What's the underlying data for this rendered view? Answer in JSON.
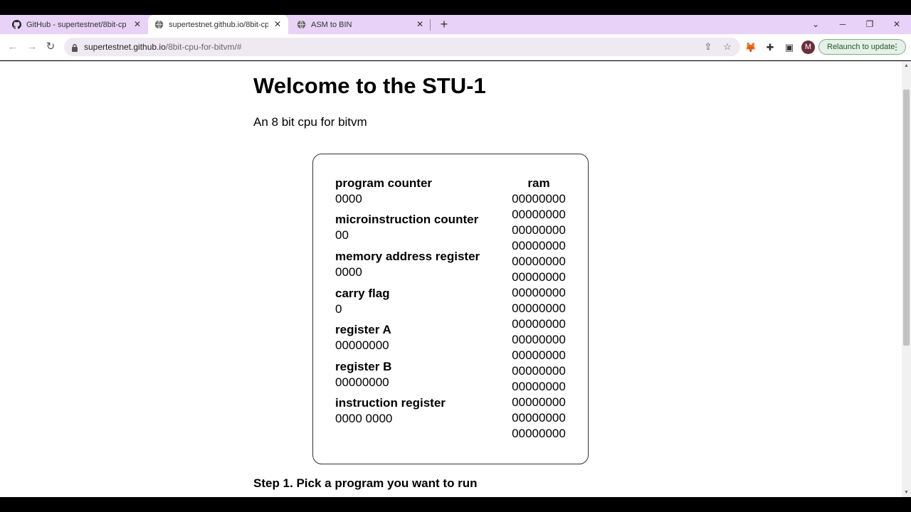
{
  "browser": {
    "tabs": [
      {
        "title": "GitHub - supertestnet/8bit-cpu-",
        "icon": "github-icon",
        "active": false
      },
      {
        "title": "supertestnet.github.io/8bit-cpu-",
        "icon": "globe-icon",
        "active": true
      },
      {
        "title": "ASM to BIN",
        "icon": "globe-icon",
        "active": false
      }
    ],
    "url_host": "supertestnet.github.io",
    "url_path": "/8bit-cpu-for-bitvm/#",
    "avatar_letter": "M",
    "relaunch_label": "Relaunch to update"
  },
  "page": {
    "title": "Welcome to the STU-1",
    "subtitle": "An 8 bit cpu for bitvm",
    "registers": [
      {
        "label": "program counter",
        "value": "0000"
      },
      {
        "label": "microinstruction counter",
        "value": "00"
      },
      {
        "label": "memory address register",
        "value": "0000"
      },
      {
        "label": "carry flag",
        "value": "0"
      },
      {
        "label": "register A",
        "value": "00000000"
      },
      {
        "label": "register B",
        "value": "00000000"
      },
      {
        "label": "instruction register",
        "value": "0000 0000"
      }
    ],
    "ram_label": "ram",
    "ram": [
      "00000000",
      "00000000",
      "00000000",
      "00000000",
      "00000000",
      "00000000",
      "00000000",
      "00000000",
      "00000000",
      "00000000",
      "00000000",
      "00000000",
      "00000000",
      "00000000",
      "00000000",
      "00000000"
    ],
    "step1": "Step 1. Pick a program you want to run"
  }
}
